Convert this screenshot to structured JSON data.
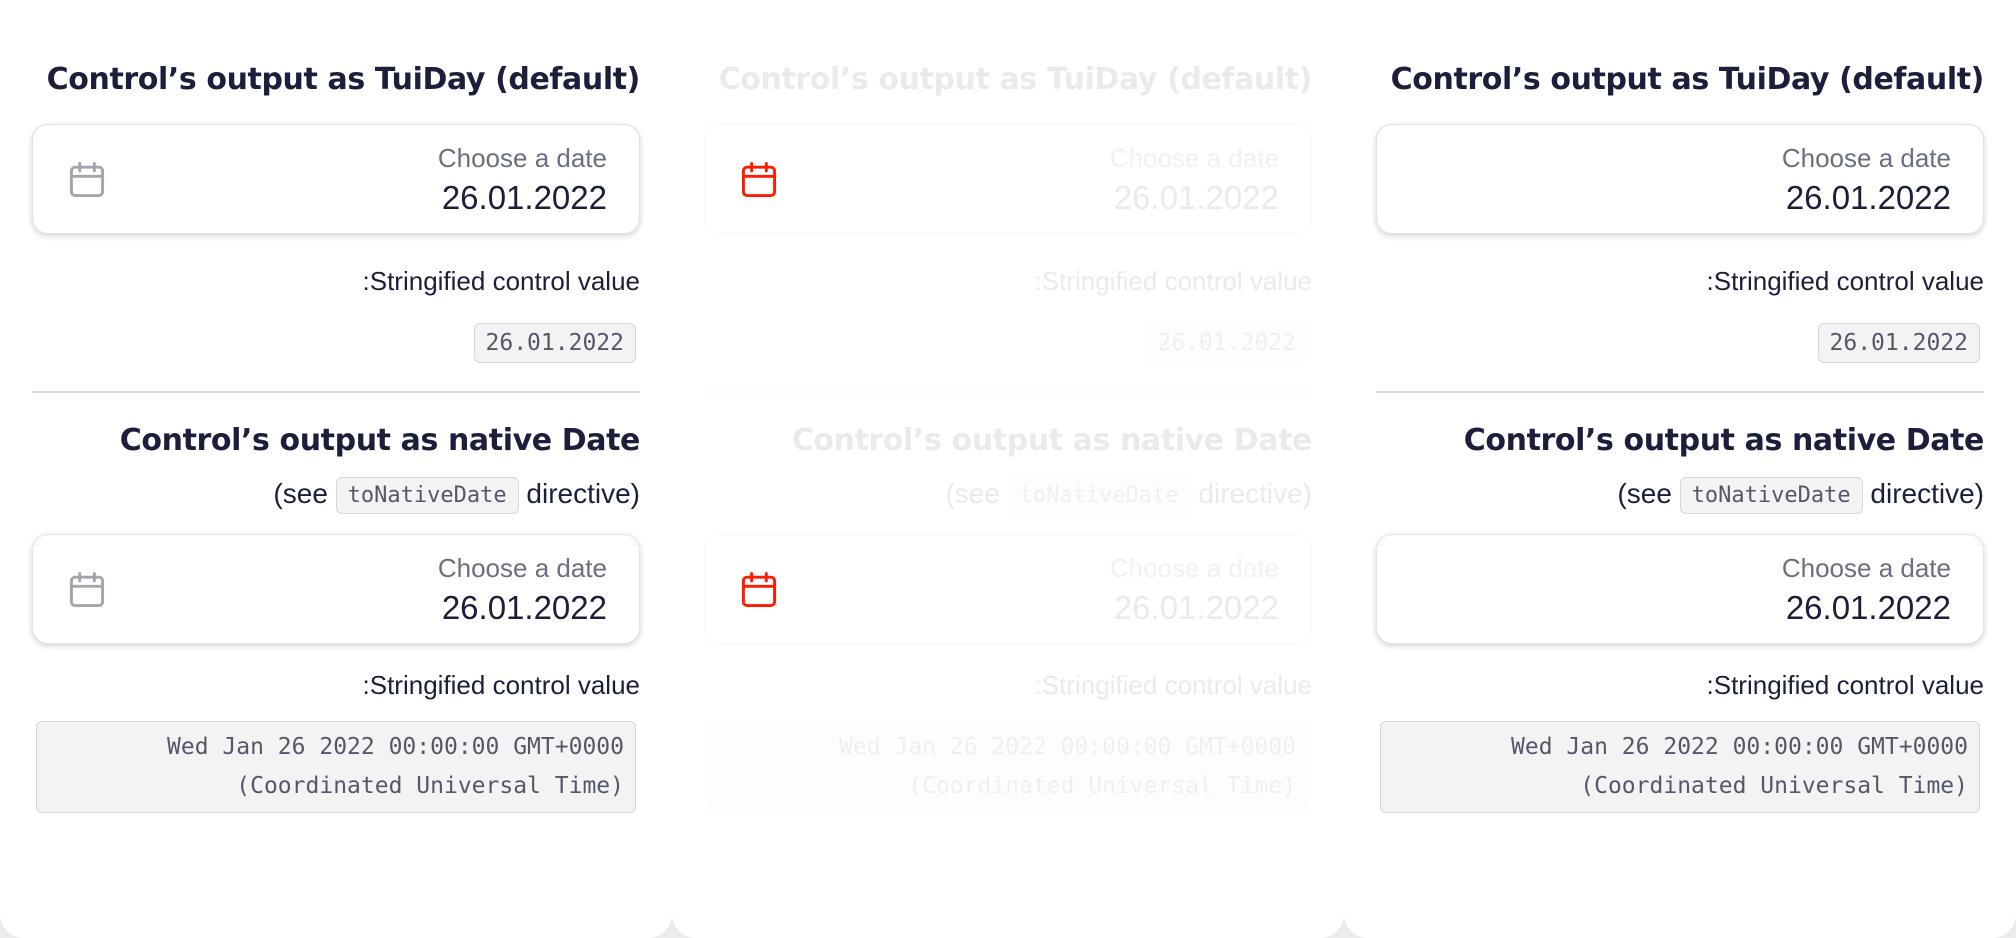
{
  "columns": [
    {
      "variant": "default",
      "calendar_icon": "calendar-icon",
      "icon_color": "#a3a5ae",
      "show_icon": true,
      "faded": false,
      "section1": {
        "heading": "Control’s output as TuiDay (default)",
        "input": {
          "label": "Choose a date",
          "value": "26.01.2022"
        },
        "caption": ":Stringified control value",
        "output": "26.01.2022"
      },
      "section2": {
        "heading": "Control’s output as native Date",
        "see_prefix": "(see",
        "see_code": "toNativeDate",
        "see_suffix": "directive)",
        "input": {
          "label": "Choose a date",
          "value": "26.01.2022"
        },
        "caption": ":Stringified control value",
        "output_line1": "Wed Jan 26 2022 00:00:00 GMT+0000",
        "output_line2": "(Coordinated Universal Time)"
      }
    },
    {
      "variant": "faded",
      "calendar_icon": "calendar-icon",
      "icon_color": "#ff1a00",
      "show_icon": true,
      "faded": true,
      "section1": {
        "heading": "Control’s output as TuiDay (default)",
        "input": {
          "label": "Choose a date",
          "value": "26.01.2022"
        },
        "caption": ":Stringified control value",
        "output": "26.01.2022"
      },
      "section2": {
        "heading": "Control’s output as native Date",
        "see_prefix": "(see",
        "see_code": "toNativeDate",
        "see_suffix": "directive)",
        "input": {
          "label": "Choose a date",
          "value": "26.01.2022"
        },
        "caption": ":Stringified control value",
        "output_line1": "Wed Jan 26 2022 00:00:00 GMT+0000",
        "output_line2": "(Coordinated Universal Time)"
      }
    },
    {
      "variant": "no-icon",
      "calendar_icon": "",
      "icon_color": "",
      "show_icon": false,
      "faded": false,
      "section1": {
        "heading": "Control’s output as TuiDay (default)",
        "input": {
          "label": "Choose a date",
          "value": "26.01.2022"
        },
        "caption": ":Stringified control value",
        "output": "26.01.2022"
      },
      "section2": {
        "heading": "Control’s output as native Date",
        "see_prefix": "(see",
        "see_code": "toNativeDate",
        "see_suffix": "directive)",
        "input": {
          "label": "Choose a date",
          "value": "26.01.2022"
        },
        "caption": ":Stringified control value",
        "output_line1": "Wed Jan 26 2022 00:00:00 GMT+0000",
        "output_line2": "(Coordinated Universal Time)"
      }
    }
  ]
}
